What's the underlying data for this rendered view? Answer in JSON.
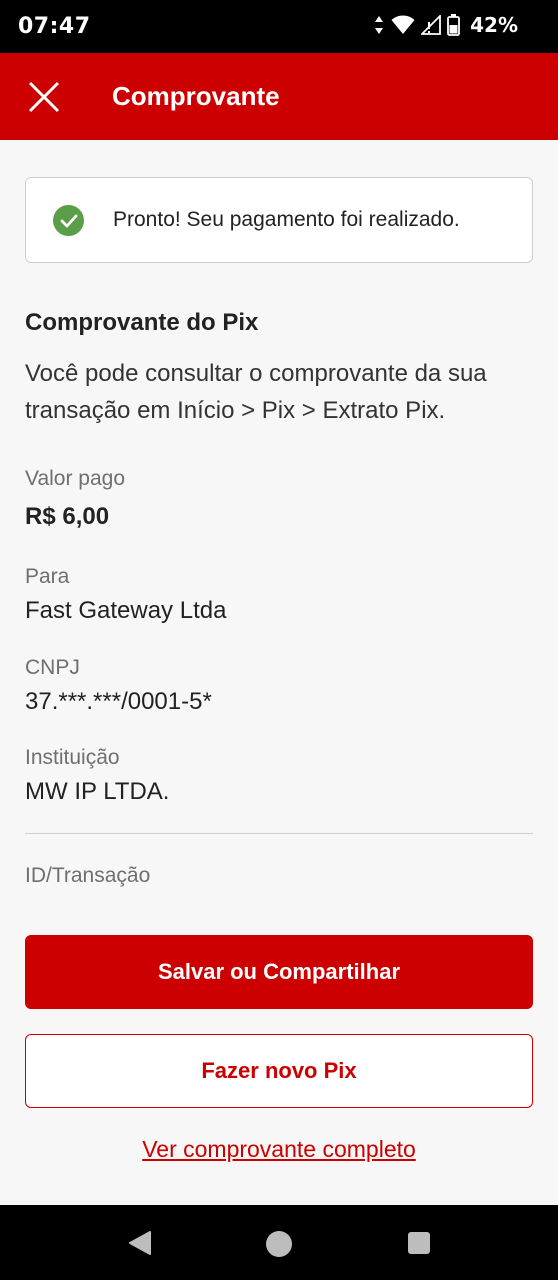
{
  "status_bar": {
    "time": "07:47",
    "battery_percent": "42%",
    "icons": [
      "data-arrows-icon",
      "wifi-icon",
      "signal-icon",
      "battery-icon"
    ]
  },
  "header": {
    "title": "Comprovante",
    "close_icon": "close-icon",
    "background_color": "#cc0000"
  },
  "alert": {
    "icon": "check-circle-icon",
    "message": "Pronto! Seu pagamento foi realizado."
  },
  "receipt": {
    "title": "Comprovante do Pix",
    "description": "Você pode consultar o comprovante da sua transação em Início > Pix > Extrato Pix.",
    "fields": [
      {
        "label": "Valor pago",
        "value": "R$ 6,00"
      },
      {
        "label": "Para",
        "value": "Fast Gateway Ltda"
      },
      {
        "label": "CNPJ",
        "value": "37.***.***/0001-5*"
      },
      {
        "label": "Instituição",
        "value": "MW IP LTDA."
      }
    ],
    "transaction_id_label": "ID/Transação"
  },
  "actions": {
    "primary_label": "Salvar ou Compartilhar",
    "secondary_label": "Fazer novo Pix",
    "link_label": "Ver comprovante completo"
  },
  "nav_bar": {
    "icons": [
      "back-icon",
      "home-icon",
      "recents-icon"
    ]
  }
}
